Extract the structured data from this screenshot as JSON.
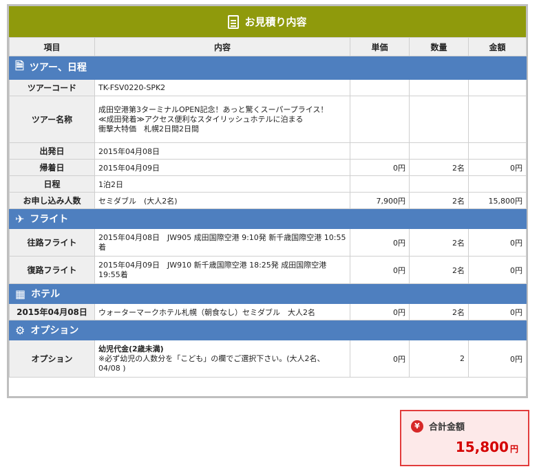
{
  "title": "お見積り内容",
  "headers": [
    "項目",
    "内容",
    "単価",
    "数量",
    "金額"
  ],
  "sections": {
    "tour": {
      "name": "ツアー、日程",
      "icon": "document-icon"
    },
    "flight": {
      "name": "フライト",
      "icon": "airplane-icon"
    },
    "hotel": {
      "name": "ホテル",
      "icon": "hotel-icon"
    },
    "option": {
      "name": "オプション",
      "icon": "gear-icon"
    }
  },
  "tour_rows": [
    {
      "label": "ツアーコード",
      "content": "TK-FSV0220-SPK2",
      "price": "",
      "qty": "",
      "amount": ""
    },
    {
      "label": "ツアー名称",
      "content": "成田空港第3ターミナルOPEN記念！あっと驚くスーパープライス！\n≪成田発着≫アクセス便利なスタイリッシュホテルに泊まる\n衝撃大特価　札幌2日間2日間",
      "price": "",
      "qty": "",
      "amount": ""
    },
    {
      "label": "出発日",
      "content": "2015年04月08日",
      "price": "",
      "qty": "",
      "amount": ""
    },
    {
      "label": "帰着日",
      "content": "2015年04月09日",
      "price": "0円",
      "qty": "2名",
      "amount": "0円"
    },
    {
      "label": "日程",
      "content": "1泊2日",
      "price": "",
      "qty": "",
      "amount": ""
    },
    {
      "label": "お申し込み人数",
      "content": "セミダブル　(大人2名)",
      "price": "7,900円",
      "qty": "2名",
      "amount": "15,800円"
    }
  ],
  "flight_rows": [
    {
      "label": "往路フライト",
      "content": "2015年04月08日　JW905 成田国際空港 9:10発 新千歳国際空港 10:55着",
      "price": "0円",
      "qty": "2名",
      "amount": "0円"
    },
    {
      "label": "復路フライト",
      "content": "2015年04月09日　JW910 新千歳国際空港 18:25発 成田国際空港 19:55着",
      "price": "0円",
      "qty": "2名",
      "amount": "0円"
    }
  ],
  "hotel_rows": [
    {
      "label": "2015年04月08日",
      "content": "ウォーターマークホテル札幌（朝食なし）セミダブル　大人2名",
      "price": "0円",
      "qty": "2名",
      "amount": "0円"
    }
  ],
  "option_rows": [
    {
      "label": "オプション",
      "content_title": "幼児代金(2歳未満)",
      "content": "※必ず幼児の人数分を「こども」の欄でご選択下さい。(大人2名、04/08 )",
      "price": "0円",
      "qty": "2",
      "amount": "0円"
    }
  ],
  "total": {
    "label": "合計金額",
    "amount": "15,800",
    "unit": "円",
    "icon": "yen-icon"
  }
}
